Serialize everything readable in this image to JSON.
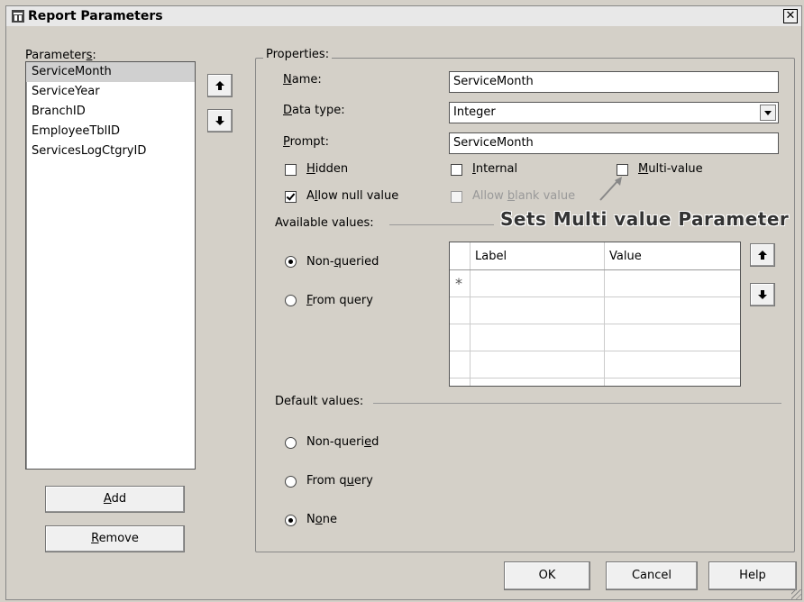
{
  "window": {
    "title": "Report Parameters",
    "close_glyph": "✕"
  },
  "parameters": {
    "label_pre": "Parameter",
    "label_key": "s",
    "label_post": ":",
    "items": [
      "ServiceMonth",
      "ServiceYear",
      "BranchID",
      "EmployeeTblID",
      "ServicesLogCtgryID"
    ],
    "selected": "ServiceMonth"
  },
  "buttons": {
    "add": {
      "key": "A",
      "rest": "dd"
    },
    "remove": {
      "key": "R",
      "rest": "emove"
    },
    "ok": "OK",
    "cancel": "Cancel",
    "help": "Help"
  },
  "properties": {
    "legend": "Properties:",
    "name": {
      "key": "N",
      "rest": "ame:",
      "value": "ServiceMonth"
    },
    "data_type": {
      "key": "D",
      "rest": "ata type:",
      "value": "Integer"
    },
    "prompt": {
      "key": "P",
      "rest": "rompt:",
      "value": "ServiceMonth"
    },
    "hidden": {
      "key": "H",
      "rest": "idden",
      "checked": false
    },
    "internal": {
      "key": "I",
      "rest": "nternal",
      "checked": false
    },
    "multi_value": {
      "key": "M",
      "rest": "ulti-value",
      "checked": false
    },
    "allow_null": {
      "pre": "A",
      "key": "l",
      "rest": "low null value",
      "checked": true
    },
    "allow_blank": {
      "pre": "Allow ",
      "key": "b",
      "rest": "lank value",
      "checked": false,
      "disabled": true
    }
  },
  "available_values": {
    "label": "Available values:",
    "non_queried": {
      "pre": "Non-",
      "key": "q",
      "rest": "ueried",
      "selected": true
    },
    "from_query": {
      "key": "F",
      "rest": "rom query",
      "selected": false
    },
    "grid": {
      "columns": [
        "Label",
        "Value"
      ],
      "new_row_marker": "*"
    }
  },
  "default_values": {
    "label": "Default values:",
    "non_queried": {
      "pre": "Non-queri",
      "key": "e",
      "rest": "d",
      "selected": false
    },
    "from_query": {
      "pre": "From q",
      "key": "u",
      "rest": "ery",
      "selected": false
    },
    "none": {
      "pre": "N",
      "key": "o",
      "rest": "ne",
      "selected": true
    }
  },
  "annotation": "Sets Multi value Parameter",
  "colors": {
    "dialog_bg": "#d4d0c8",
    "selection": "#d0d0d0"
  }
}
